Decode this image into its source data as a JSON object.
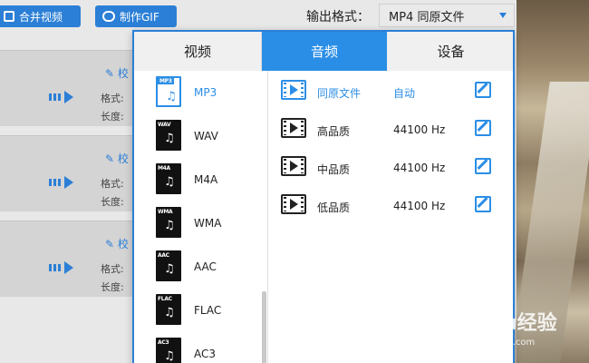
{
  "toolbar": {
    "merge_label": "合并视频",
    "gif_label": "制作GIF",
    "output_label": "输出格式：",
    "output_value": "MP4  同原文件"
  },
  "tasks": [
    {
      "edit_text": "校",
      "format_label": "格式:",
      "length_label": "长度:"
    },
    {
      "edit_text": "校",
      "format_label": "格式:",
      "length_label": "长度:"
    },
    {
      "edit_text": "校",
      "format_label": "格式:",
      "length_label": "长度:"
    }
  ],
  "popup": {
    "tabs": [
      {
        "label": "视频"
      },
      {
        "label": "音频",
        "active": true
      },
      {
        "label": "设备"
      }
    ],
    "formats": [
      {
        "name": "MP3",
        "selected": true
      },
      {
        "name": "WAV"
      },
      {
        "name": "M4A"
      },
      {
        "name": "WMA"
      },
      {
        "name": "AAC"
      },
      {
        "name": "FLAC"
      },
      {
        "name": "AC3"
      }
    ],
    "qualities": [
      {
        "name": "同原文件",
        "rate": "自动",
        "active": true
      },
      {
        "name": "高品质",
        "rate": "44100 Hz"
      },
      {
        "name": "中品质",
        "rate": "44100 Hz"
      },
      {
        "name": "低品质",
        "rate": "44100 Hz"
      }
    ]
  },
  "watermark": {
    "logo": "Baidu经验",
    "url": "jingyan.baidu.com"
  },
  "colors": {
    "accent": "#2b8ee6",
    "button": "#2b7fd6"
  }
}
